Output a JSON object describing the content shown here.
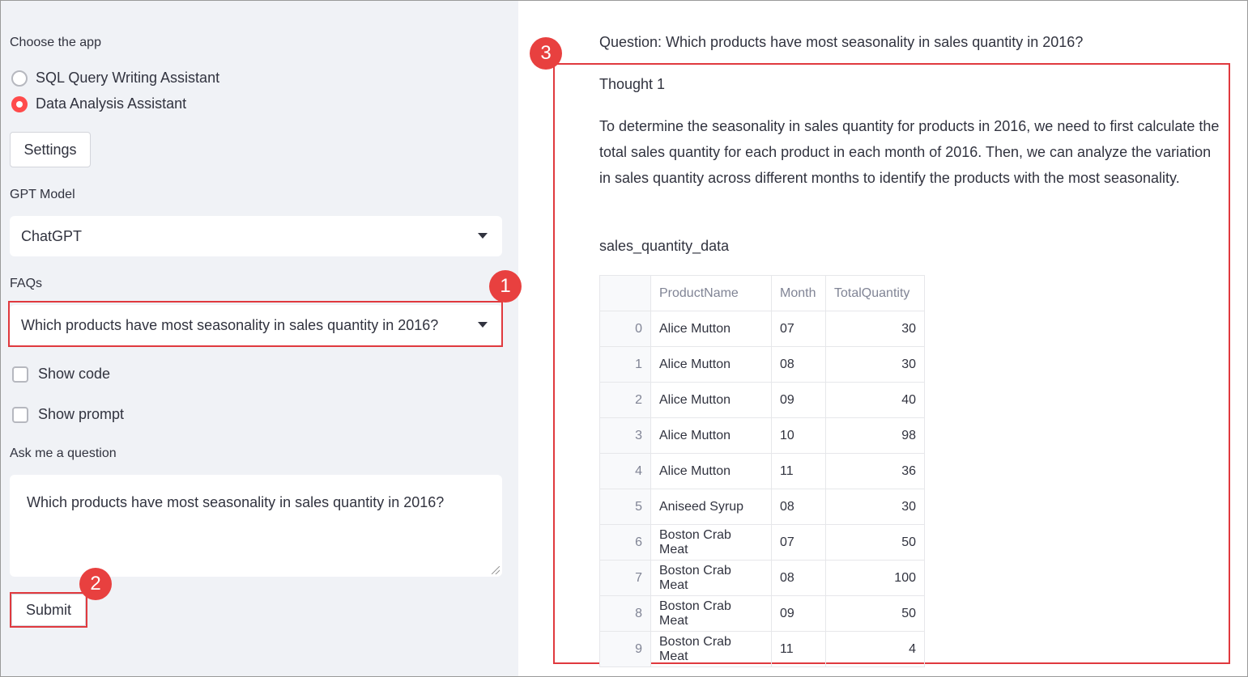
{
  "sidebar": {
    "choose_app_label": "Choose the app",
    "apps": [
      {
        "label": "SQL Query Writing Assistant",
        "selected": false
      },
      {
        "label": "Data Analysis Assistant",
        "selected": true
      }
    ],
    "settings_button": "Settings",
    "gpt_model_label": "GPT Model",
    "gpt_model_value": "ChatGPT",
    "faqs_label": "FAQs",
    "faqs_value": "Which products have most seasonality in sales quantity in 2016?",
    "show_code_label": "Show code",
    "show_prompt_label": "Show prompt",
    "ask_label": "Ask me a question",
    "question_value": "Which products have most seasonality in sales quantity in 2016?",
    "submit_button": "Submit"
  },
  "badges": [
    "1",
    "2",
    "3"
  ],
  "main": {
    "question": "Question: Which products have most seasonality in sales quantity in 2016?",
    "thought_title": "Thought 1",
    "thought_text": "To determine the seasonality in sales quantity for products in 2016, we need to first calculate the total sales quantity for each product in each month of 2016. Then, we can analyze the variation in sales quantity across different months to identify the products with the most seasonality.",
    "table_title": "sales_quantity_data",
    "table": {
      "columns": [
        "",
        "ProductName",
        "Month",
        "TotalQuantity"
      ],
      "rows": [
        [
          "0",
          "Alice Mutton",
          "07",
          "30"
        ],
        [
          "1",
          "Alice Mutton",
          "08",
          "30"
        ],
        [
          "2",
          "Alice Mutton",
          "09",
          "40"
        ],
        [
          "3",
          "Alice Mutton",
          "10",
          "98"
        ],
        [
          "4",
          "Alice Mutton",
          "11",
          "36"
        ],
        [
          "5",
          "Aniseed Syrup",
          "08",
          "30"
        ],
        [
          "6",
          "Boston Crab Meat",
          "07",
          "50"
        ],
        [
          "7",
          "Boston Crab Meat",
          "08",
          "100"
        ],
        [
          "8",
          "Boston Crab Meat",
          "09",
          "50"
        ],
        [
          "9",
          "Boston Crab Meat",
          "11",
          "4"
        ]
      ]
    }
  },
  "colors": {
    "accent": "#ff4b4b",
    "annotation": "#e0393e",
    "sidebar_bg": "#f0f2f6"
  }
}
